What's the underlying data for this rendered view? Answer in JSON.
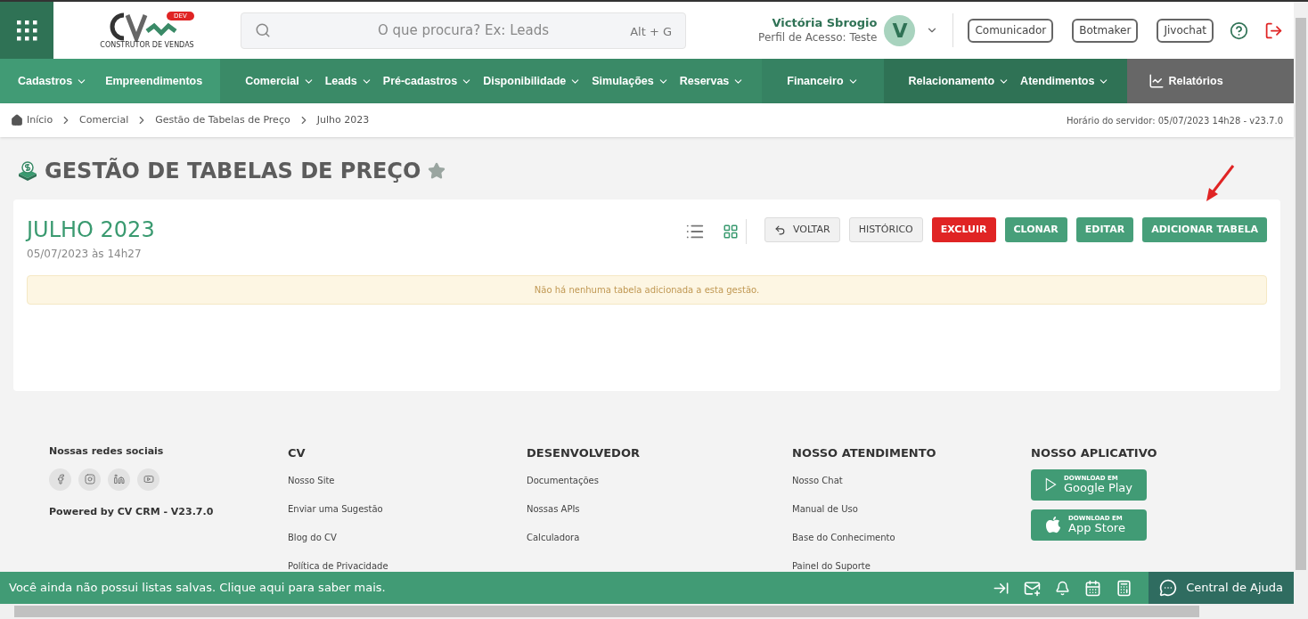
{
  "header": {
    "logo_tag": "DEV",
    "logo_caption": "CONSTRUTOR DE VENDAS",
    "search": {
      "placeholder": "O que procura? Ex: Leads",
      "shortcut": "Alt + G"
    },
    "user": {
      "name": "Victória Sbrogio",
      "profile": "Perfil de Acesso: Teste",
      "initial": "V"
    },
    "buttons": [
      "Comunicador",
      "Botmaker",
      "Jivochat"
    ]
  },
  "nav": [
    {
      "items": [
        {
          "label": "Cadastros",
          "dropdown": true
        },
        {
          "label": "Empreendimentos",
          "dropdown": false
        }
      ]
    },
    {
      "items": [
        {
          "label": "Comercial",
          "dropdown": true
        },
        {
          "label": "Leads",
          "dropdown": true
        },
        {
          "label": "Pré-cadastros",
          "dropdown": true
        },
        {
          "label": "Disponibilidade",
          "dropdown": true
        },
        {
          "label": "Simulações",
          "dropdown": true
        },
        {
          "label": "Reservas",
          "dropdown": true
        }
      ]
    },
    {
      "items": [
        {
          "label": "Financeiro",
          "dropdown": true
        }
      ]
    },
    {
      "items": [
        {
          "label": "Relacionamento",
          "dropdown": true
        },
        {
          "label": "Atendimentos",
          "dropdown": true
        }
      ]
    },
    {
      "items": [
        {
          "label": "Relatórios",
          "dropdown": false,
          "kind": "reports"
        }
      ]
    }
  ],
  "breadcrumb": [
    "Início",
    "Comercial",
    "Gestão de Tabelas de Preço",
    "Julho 2023"
  ],
  "server_time": "Horário do servidor: 05/07/2023 14h28 - v23.7.0",
  "page_title": "GESTÃO DE TABELAS DE PREÇO",
  "card": {
    "title": "JULHO 2023",
    "subtitle": "05/07/2023 às 14h27",
    "views": [
      {
        "kind": "list",
        "selected": false
      },
      {
        "kind": "grid",
        "selected": true
      }
    ],
    "buttons": [
      {
        "label": "VOLTAR",
        "kind": "back"
      },
      {
        "label": "HISTÓRICO",
        "kind": "plain"
      },
      {
        "label": "EXCLUIR",
        "kind": "danger"
      },
      {
        "label": "CLONAR",
        "kind": "primary"
      },
      {
        "label": "EDITAR",
        "kind": "primary"
      },
      {
        "label": "ADICIONAR TABELA",
        "kind": "primary"
      }
    ],
    "alert": "Não há nenhuma tabela adicionada a esta gestão."
  },
  "footer": {
    "social_heading": "Nossas redes sociais",
    "powered": "Powered by CV CRM - V23.7.0",
    "columns": [
      {
        "heading": "CV",
        "links": [
          "Nosso Site",
          "Enviar uma Sugestão",
          "Blog do CV",
          "Política de Privacidade"
        ]
      },
      {
        "heading": "DESENVOLVEDOR",
        "links": [
          "Documentações",
          "Nossas APIs",
          "Calculadora"
        ]
      },
      {
        "heading": "NOSSO ATENDIMENTO",
        "links": [
          "Nosso Chat",
          "Manual de Uso",
          "Base do Conhecimento",
          "Painel do Suporte"
        ]
      }
    ],
    "app_heading": "NOSSO APLICATIVO",
    "stores": [
      {
        "kind": "google",
        "small": "DOWNLOAD EM",
        "big": "Google Play"
      },
      {
        "kind": "apple",
        "small": "DOWNLOAD EM",
        "big": "App Store"
      }
    ]
  },
  "bottom_bar": {
    "message": "Você ainda não possui listas salvas. Clique aqui para saber mais.",
    "help": "Central de Ajuda"
  }
}
